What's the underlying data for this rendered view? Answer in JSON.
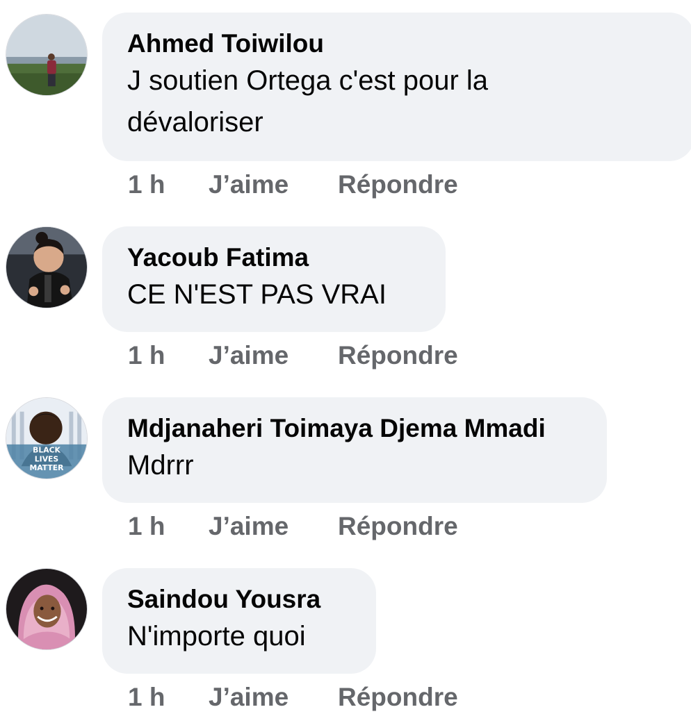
{
  "comments": [
    {
      "author": "Ahmed Toiwilou",
      "text_lines": [
        "J soutien Ortega c'est pour la",
        "dévaloriser"
      ],
      "time": "1 h",
      "like_label": "J’aime",
      "reply_label": "Répondre",
      "avatar": "avatar-man-standing-in-field"
    },
    {
      "author": "Yacoub Fatima",
      "text_lines": [
        "CE N'EST PAS VRAI"
      ],
      "time": "1 h",
      "like_label": "J’aime",
      "reply_label": "Répondre",
      "avatar": "avatar-baby-in-leather-jacket"
    },
    {
      "author": "Mdjanaheri Toimaya Djema Mmadi",
      "text_lines": [
        "Mdrrr"
      ],
      "time": "1 h",
      "like_label": "J’aime",
      "reply_label": "Répondre",
      "avatar": "avatar-boy-black-lives-matter-frame",
      "avatar_overlay_text": [
        "BLACK",
        "LIVES",
        "MATTER"
      ]
    },
    {
      "author": "Saindou Yousra",
      "text_lines": [
        "N'importe quoi"
      ],
      "time": "1 h",
      "like_label": "J’aime",
      "reply_label": "Répondre",
      "avatar": "avatar-girl-in-pink-hijab"
    }
  ],
  "colors": {
    "bubble": "#f0f2f5",
    "name": "#050505",
    "text": "#050505",
    "meta": "#65676b"
  }
}
